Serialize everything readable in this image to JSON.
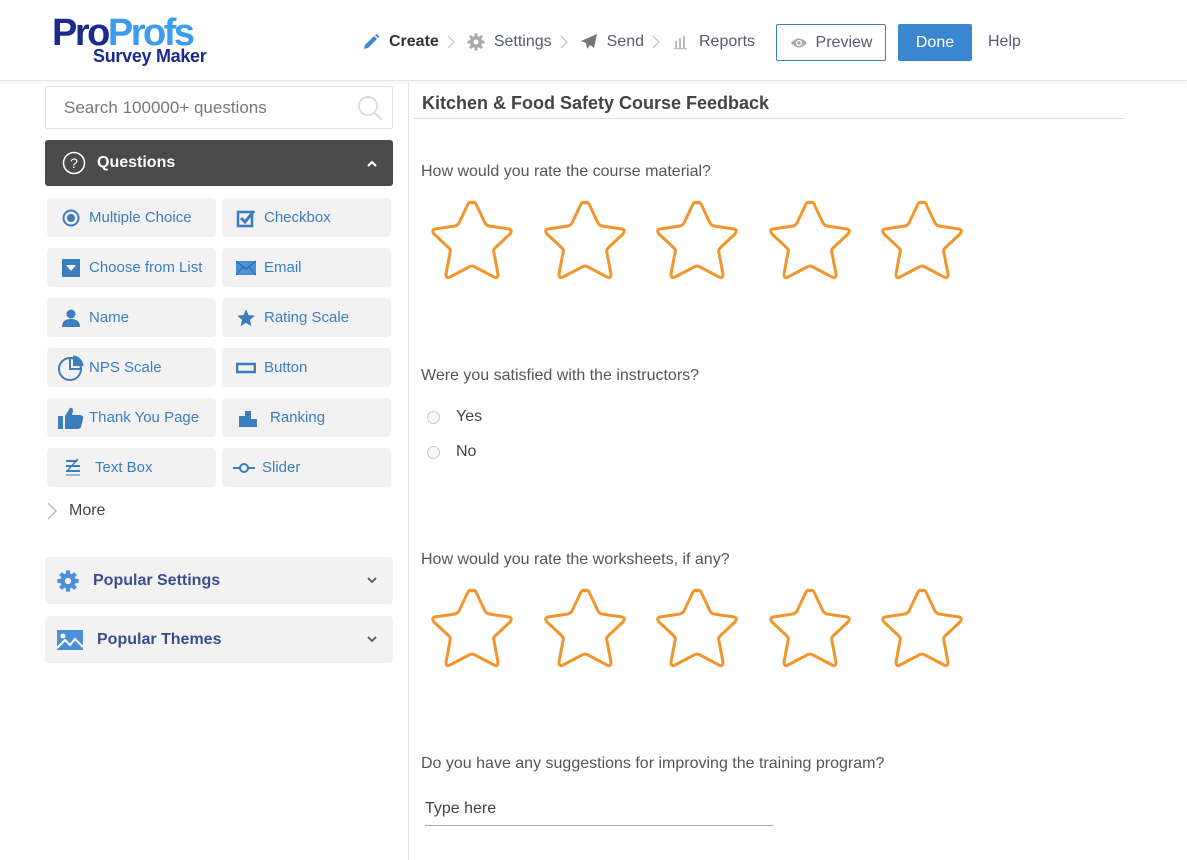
{
  "app": {
    "logo": {
      "pro": "Pro",
      "profs": "Profs",
      "subtitle": "Survey Maker"
    }
  },
  "nav": {
    "steps": [
      {
        "label": "Create",
        "icon": "pencil-icon",
        "active": true
      },
      {
        "label": "Settings",
        "icon": "gear-icon",
        "active": false
      },
      {
        "label": "Send",
        "icon": "paper-plane-icon",
        "active": false
      },
      {
        "label": "Reports",
        "icon": "bar-chart-icon",
        "active": false
      }
    ],
    "preview_label": "Preview",
    "done_label": "Done",
    "help_label": "Help"
  },
  "sidebar": {
    "search": {
      "placeholder": "Search 100000+ questions",
      "value": ""
    },
    "questions_header": "Questions",
    "question_types": [
      {
        "label": "Multiple Choice",
        "icon": "radio-icon"
      },
      {
        "label": "Checkbox",
        "icon": "checkbox-icon"
      },
      {
        "label": "Choose from List",
        "icon": "dropdown-icon"
      },
      {
        "label": "Email",
        "icon": "envelope-icon"
      },
      {
        "label": "Name",
        "icon": "person-icon"
      },
      {
        "label": "Rating Scale",
        "icon": "star-icon"
      },
      {
        "label": "NPS Scale",
        "icon": "pie-chart-icon"
      },
      {
        "label": "Button",
        "icon": "button-icon"
      },
      {
        "label": "Thank You Page",
        "icon": "thumbs-up-icon"
      },
      {
        "label": "Ranking",
        "icon": "podium-icon"
      },
      {
        "label": "Text Box",
        "icon": "text-lines-icon"
      },
      {
        "label": "Slider",
        "icon": "slider-icon"
      }
    ],
    "more_label": "More",
    "popular_settings": "Popular Settings",
    "popular_themes": "Popular Themes"
  },
  "survey": {
    "title": "Kitchen & Food Safety Course Feedback",
    "questions": [
      {
        "text": "How would you rate the course material?",
        "type": "rating",
        "stars": 5,
        "selected": 0
      },
      {
        "text": "Were you satisfied with the instructors?",
        "type": "radio",
        "options": [
          "Yes",
          "No"
        ]
      },
      {
        "text": "How would you rate the worksheets, if any?",
        "type": "rating",
        "stars": 5,
        "selected": 0
      },
      {
        "text": "Do you have any suggestions for improving the training program?",
        "type": "text",
        "placeholder": "Type here",
        "value": ""
      }
    ]
  },
  "colors": {
    "accent": "#3a87cf",
    "icon_blue": "#3c7dbe",
    "star_outline": "#f0962c",
    "header_dark": "#4a4a4a",
    "logo_dark": "#1b2a8c",
    "logo_light": "#3b9cf0"
  }
}
